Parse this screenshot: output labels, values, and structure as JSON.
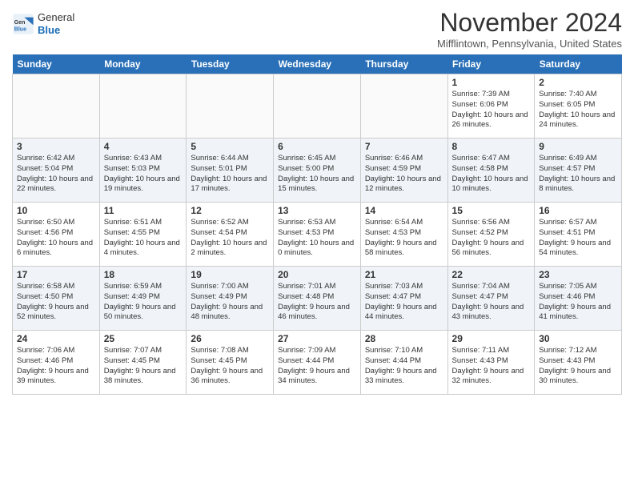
{
  "header": {
    "logo_general": "General",
    "logo_blue": "Blue",
    "month_title": "November 2024",
    "subtitle": "Mifflintown, Pennsylvania, United States"
  },
  "days_of_week": [
    "Sunday",
    "Monday",
    "Tuesday",
    "Wednesday",
    "Thursday",
    "Friday",
    "Saturday"
  ],
  "weeks": [
    [
      {
        "day": "",
        "info": ""
      },
      {
        "day": "",
        "info": ""
      },
      {
        "day": "",
        "info": ""
      },
      {
        "day": "",
        "info": ""
      },
      {
        "day": "",
        "info": ""
      },
      {
        "day": "1",
        "info": "Sunrise: 7:39 AM\nSunset: 6:06 PM\nDaylight: 10 hours and 26 minutes."
      },
      {
        "day": "2",
        "info": "Sunrise: 7:40 AM\nSunset: 6:05 PM\nDaylight: 10 hours and 24 minutes."
      }
    ],
    [
      {
        "day": "3",
        "info": "Sunrise: 6:42 AM\nSunset: 5:04 PM\nDaylight: 10 hours and 22 minutes."
      },
      {
        "day": "4",
        "info": "Sunrise: 6:43 AM\nSunset: 5:03 PM\nDaylight: 10 hours and 19 minutes."
      },
      {
        "day": "5",
        "info": "Sunrise: 6:44 AM\nSunset: 5:01 PM\nDaylight: 10 hours and 17 minutes."
      },
      {
        "day": "6",
        "info": "Sunrise: 6:45 AM\nSunset: 5:00 PM\nDaylight: 10 hours and 15 minutes."
      },
      {
        "day": "7",
        "info": "Sunrise: 6:46 AM\nSunset: 4:59 PM\nDaylight: 10 hours and 12 minutes."
      },
      {
        "day": "8",
        "info": "Sunrise: 6:47 AM\nSunset: 4:58 PM\nDaylight: 10 hours and 10 minutes."
      },
      {
        "day": "9",
        "info": "Sunrise: 6:49 AM\nSunset: 4:57 PM\nDaylight: 10 hours and 8 minutes."
      }
    ],
    [
      {
        "day": "10",
        "info": "Sunrise: 6:50 AM\nSunset: 4:56 PM\nDaylight: 10 hours and 6 minutes."
      },
      {
        "day": "11",
        "info": "Sunrise: 6:51 AM\nSunset: 4:55 PM\nDaylight: 10 hours and 4 minutes."
      },
      {
        "day": "12",
        "info": "Sunrise: 6:52 AM\nSunset: 4:54 PM\nDaylight: 10 hours and 2 minutes."
      },
      {
        "day": "13",
        "info": "Sunrise: 6:53 AM\nSunset: 4:53 PM\nDaylight: 10 hours and 0 minutes."
      },
      {
        "day": "14",
        "info": "Sunrise: 6:54 AM\nSunset: 4:53 PM\nDaylight: 9 hours and 58 minutes."
      },
      {
        "day": "15",
        "info": "Sunrise: 6:56 AM\nSunset: 4:52 PM\nDaylight: 9 hours and 56 minutes."
      },
      {
        "day": "16",
        "info": "Sunrise: 6:57 AM\nSunset: 4:51 PM\nDaylight: 9 hours and 54 minutes."
      }
    ],
    [
      {
        "day": "17",
        "info": "Sunrise: 6:58 AM\nSunset: 4:50 PM\nDaylight: 9 hours and 52 minutes."
      },
      {
        "day": "18",
        "info": "Sunrise: 6:59 AM\nSunset: 4:49 PM\nDaylight: 9 hours and 50 minutes."
      },
      {
        "day": "19",
        "info": "Sunrise: 7:00 AM\nSunset: 4:49 PM\nDaylight: 9 hours and 48 minutes."
      },
      {
        "day": "20",
        "info": "Sunrise: 7:01 AM\nSunset: 4:48 PM\nDaylight: 9 hours and 46 minutes."
      },
      {
        "day": "21",
        "info": "Sunrise: 7:03 AM\nSunset: 4:47 PM\nDaylight: 9 hours and 44 minutes."
      },
      {
        "day": "22",
        "info": "Sunrise: 7:04 AM\nSunset: 4:47 PM\nDaylight: 9 hours and 43 minutes."
      },
      {
        "day": "23",
        "info": "Sunrise: 7:05 AM\nSunset: 4:46 PM\nDaylight: 9 hours and 41 minutes."
      }
    ],
    [
      {
        "day": "24",
        "info": "Sunrise: 7:06 AM\nSunset: 4:46 PM\nDaylight: 9 hours and 39 minutes."
      },
      {
        "day": "25",
        "info": "Sunrise: 7:07 AM\nSunset: 4:45 PM\nDaylight: 9 hours and 38 minutes."
      },
      {
        "day": "26",
        "info": "Sunrise: 7:08 AM\nSunset: 4:45 PM\nDaylight: 9 hours and 36 minutes."
      },
      {
        "day": "27",
        "info": "Sunrise: 7:09 AM\nSunset: 4:44 PM\nDaylight: 9 hours and 34 minutes."
      },
      {
        "day": "28",
        "info": "Sunrise: 7:10 AM\nSunset: 4:44 PM\nDaylight: 9 hours and 33 minutes."
      },
      {
        "day": "29",
        "info": "Sunrise: 7:11 AM\nSunset: 4:43 PM\nDaylight: 9 hours and 32 minutes."
      },
      {
        "day": "30",
        "info": "Sunrise: 7:12 AM\nSunset: 4:43 PM\nDaylight: 9 hours and 30 minutes."
      }
    ]
  ]
}
